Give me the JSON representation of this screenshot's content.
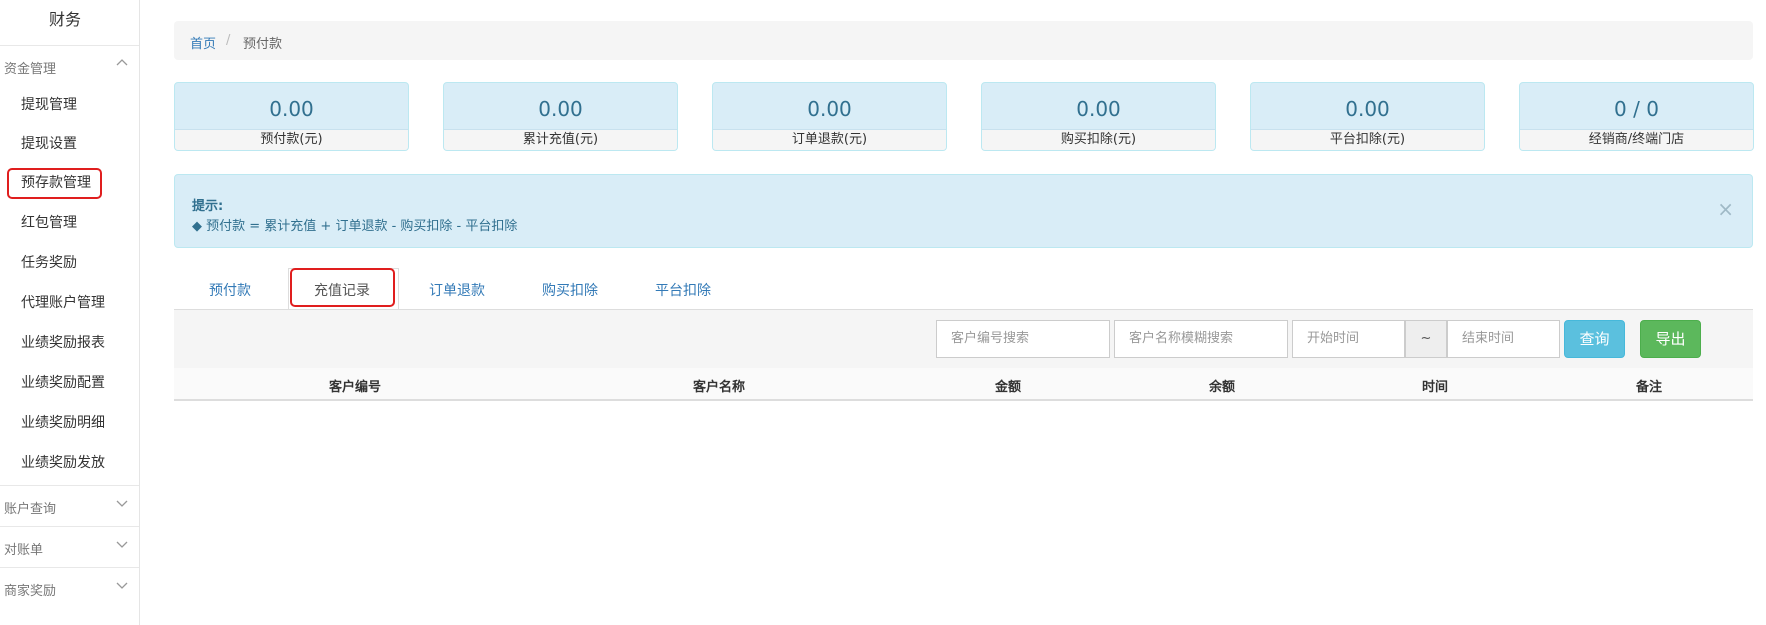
{
  "sidebar": {
    "title": "财务",
    "groups": [
      {
        "label": "资金管理",
        "expanded": true
      },
      {
        "label": "账户查询",
        "expanded": false
      },
      {
        "label": "对账单",
        "expanded": false
      },
      {
        "label": "商家奖励",
        "expanded": false
      }
    ],
    "items": [
      {
        "label": "提现管理"
      },
      {
        "label": "提现设置"
      },
      {
        "label": "预存款管理",
        "active": true
      },
      {
        "label": "红包管理"
      },
      {
        "label": "任务奖励"
      },
      {
        "label": "代理账户管理"
      },
      {
        "label": "业绩奖励报表"
      },
      {
        "label": "业绩奖励配置"
      },
      {
        "label": "业绩奖励明细"
      },
      {
        "label": "业绩奖励发放"
      }
    ]
  },
  "breadcrumb": {
    "home": "首页",
    "separator": "/",
    "current": "预付款"
  },
  "stats": [
    {
      "value": "0.00",
      "label": "预付款(元)"
    },
    {
      "value": "0.00",
      "label": "累计充值(元)"
    },
    {
      "value": "0.00",
      "label": "订单退款(元)"
    },
    {
      "value": "0.00",
      "label": "购买扣除(元)"
    },
    {
      "value": "0.00",
      "label": "平台扣除(元)"
    },
    {
      "value": "0 / 0",
      "label": "经销商/终端门店"
    }
  ],
  "hint": {
    "title": "提示:",
    "body": "◆ 预付款 = 累计充值 + 订单退款 - 购买扣除 - 平台扣除",
    "close": "×"
  },
  "tabs": [
    {
      "label": "预付款"
    },
    {
      "label": "充值记录",
      "active": true
    },
    {
      "label": "订单退款"
    },
    {
      "label": "购买扣除"
    },
    {
      "label": "平台扣除"
    }
  ],
  "filters": {
    "customer_no_placeholder": "客户编号搜索",
    "customer_name_placeholder": "客户名称模糊搜索",
    "start_placeholder": "开始时间",
    "range_sep": "~",
    "end_placeholder": "结束时间",
    "query_label": "查询",
    "export_label": "导出"
  },
  "table": {
    "columns": [
      "客户编号",
      "客户名称",
      "金额",
      "余额",
      "时间",
      "备注"
    ],
    "rows": []
  },
  "colors": {
    "accent": "#337ab7",
    "info_bg": "#d9edf7",
    "highlight": "#e01e1e",
    "query": "#5bc0de",
    "export": "#5cb85c"
  }
}
